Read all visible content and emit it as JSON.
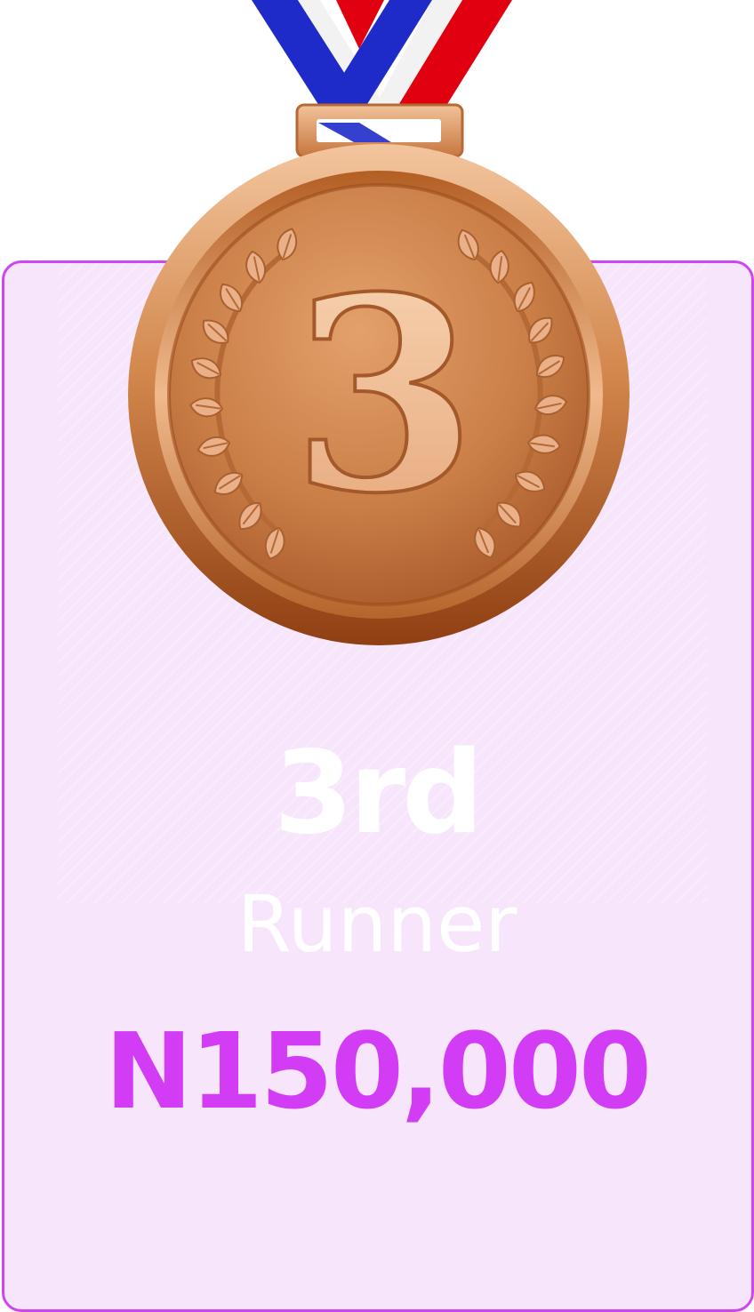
{
  "award": {
    "rank_numeral": "3",
    "place": "3rd",
    "role": "Runner",
    "prize": "N150,000"
  },
  "icons": {
    "medal": "bronze-medal-icon",
    "laurel": "laurel-wreath-icon"
  },
  "colors": {
    "card_border": "#cf45f2",
    "card_background": "#f7e5fb",
    "prize_text": "#d23cf5",
    "label_text": "#ffffff",
    "medal_bronze": "#c8834e",
    "ribbon_blue": "#1f2bc9",
    "ribbon_red": "#e0000f",
    "ribbon_white": "#f2f2f2"
  }
}
